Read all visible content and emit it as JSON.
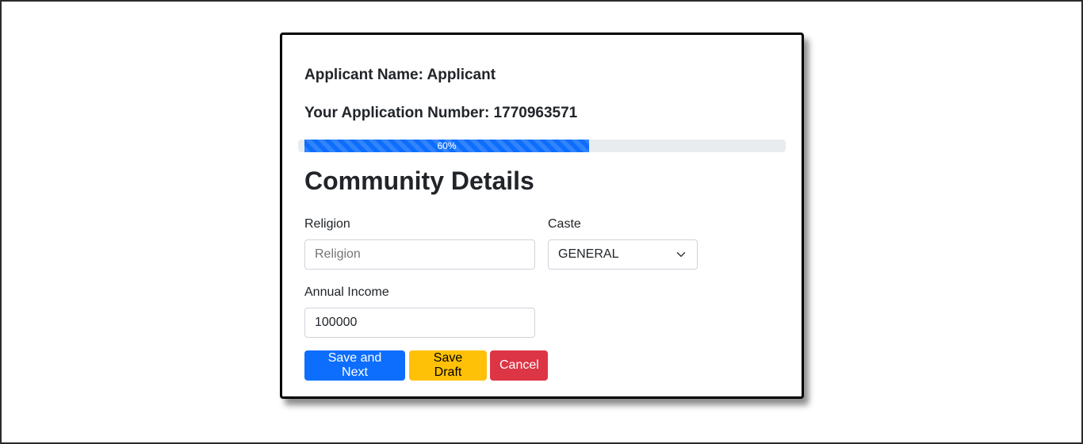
{
  "applicant": {
    "name_line": "Applicant Name: Applicant",
    "number_line": "Your Application Number: 1770963571"
  },
  "progress": {
    "value_percent": 60,
    "label": "60%"
  },
  "section": {
    "title": "Community Details"
  },
  "form": {
    "religion": {
      "label": "Religion",
      "placeholder": "Religion",
      "value": ""
    },
    "caste": {
      "label": "Caste",
      "selected": "GENERAL"
    },
    "income": {
      "label": "Annual Income",
      "value": "100000"
    }
  },
  "buttons": {
    "save_next": "Save and Next",
    "save_draft": "Save Draft",
    "cancel": "Cancel"
  },
  "colors": {
    "primary": "#0d6efd",
    "warning": "#ffc107",
    "danger": "#dc3545"
  },
  "icons": {
    "select_arrow": "chevron-down-icon"
  }
}
